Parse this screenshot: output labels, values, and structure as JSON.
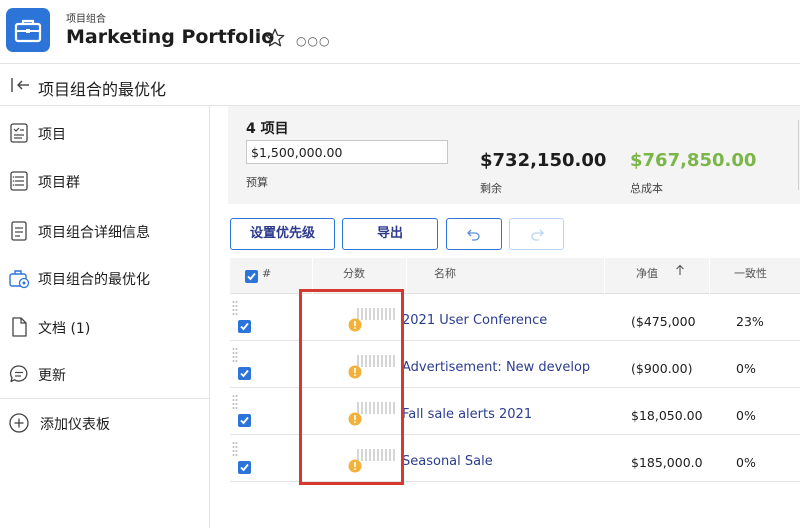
{
  "header": {
    "kicker": "项目组合",
    "title": "Marketing Portfolio",
    "icons": [
      "briefcase-icon",
      "star-icon",
      "more-icon"
    ]
  },
  "subheader": {
    "title": "项目组合的最优化",
    "icon": "collapse-panel-icon"
  },
  "sidebar": {
    "items": [
      {
        "label": "项目",
        "icon": "project-icon"
      },
      {
        "label": "项目群",
        "icon": "program-icon"
      },
      {
        "label": "项目组合详细信息",
        "icon": "details-icon"
      },
      {
        "label": "项目组合的最优化",
        "icon": "optimizer-icon"
      },
      {
        "label": "文档 (1)",
        "icon": "document-icon"
      },
      {
        "label": "更新",
        "icon": "updates-icon"
      }
    ],
    "add_dashboard": {
      "label": "添加仪表板",
      "icon": "plus-circle-icon"
    }
  },
  "summary": {
    "count": "4 项目",
    "budget_value": "$1,500,000.00",
    "budget_label": "预算",
    "remaining_value": "$732,150.00",
    "remaining_label": "剩余",
    "total_cost_value": "$767,850.00",
    "total_cost_label": "总成本"
  },
  "toolbar": {
    "prioritize_label": "设置优先级",
    "export_label": "导出",
    "undo_icon": "undo-icon",
    "redo_icon": "redo-icon"
  },
  "table": {
    "headers": {
      "hash": "#",
      "score": "分数",
      "name": "名称",
      "net_value": "净值",
      "alignment": "一致性"
    },
    "rows": [
      {
        "name": "2021 User Conference",
        "net_value": "($475,000",
        "alignment": "23%"
      },
      {
        "name": "Advertisement: New developm",
        "net_value": "($900.00)",
        "alignment": "0%"
      },
      {
        "name": "Fall sale alerts 2021",
        "net_value": "$18,050.00",
        "alignment": "0%"
      },
      {
        "name": "Seasonal Sale",
        "net_value": "$185,000.0",
        "alignment": "0%"
      }
    ]
  },
  "colors": {
    "accent": "#2d74d9",
    "link": "#2a3d8f",
    "success": "#7ab648",
    "warning": "#f2b13a",
    "highlight": "#d63a2e"
  }
}
